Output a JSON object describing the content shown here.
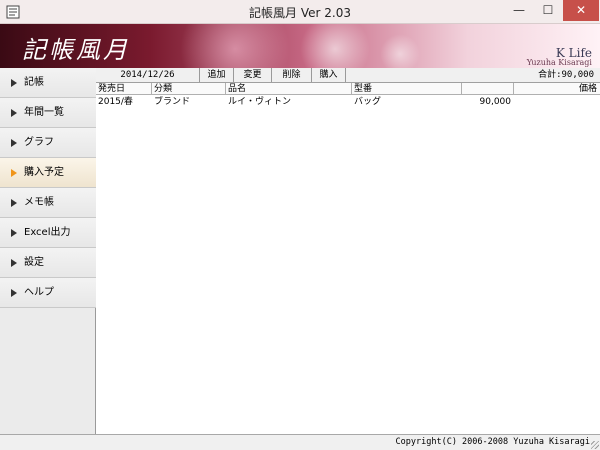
{
  "window": {
    "title": "記帳風月 Ver 2.03",
    "minimize": "—",
    "maximize": "☐",
    "close": "✕"
  },
  "banner": {
    "title": "記帳風月",
    "brand": "K Life",
    "author": "Yuzuha Kisaragi"
  },
  "sidebar": {
    "items": [
      {
        "label": "記帳",
        "active": false
      },
      {
        "label": "年間一覧",
        "active": false
      },
      {
        "label": "グラフ",
        "active": false
      },
      {
        "label": "購入予定",
        "active": true
      },
      {
        "label": "メモ帳",
        "active": false
      },
      {
        "label": "Excel出力",
        "active": false
      },
      {
        "label": "設定",
        "active": false
      },
      {
        "label": "ヘルプ",
        "active": false
      }
    ]
  },
  "toolbar": {
    "date": "2014/12/26",
    "add": "追加",
    "edit": "変更",
    "delete": "削除",
    "buy": "購入",
    "total": "合計:90,000"
  },
  "table": {
    "headers": [
      "発売日",
      "分類",
      "品名",
      "型番",
      "",
      "価格"
    ],
    "rows": [
      [
        "2015/春",
        "ブランド",
        "ルイ・ヴィトン",
        "バッグ",
        "",
        "90,000"
      ]
    ]
  },
  "status": {
    "copyright": "Copyright(C) 2006-2008 Yuzuha Kisaragi"
  },
  "colors": {
    "accent_arrow": "#f0951a",
    "close_button": "#c7504a",
    "banner_dark": "#3a0a14"
  }
}
